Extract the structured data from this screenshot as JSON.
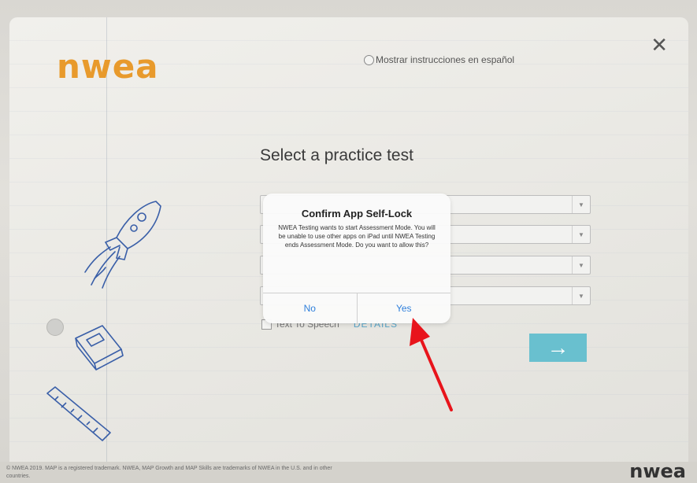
{
  "header": {
    "logo_text": "nwea",
    "language_option": "Mostrar instrucciones en español",
    "close_symbol": "✕"
  },
  "main": {
    "title": "Select a practice test",
    "selects": [
      {
        "value": ""
      },
      {
        "value": ""
      },
      {
        "value": ""
      },
      {
        "value": ""
      }
    ],
    "text_to_speech_label": "Text To Speech",
    "details_link": "DETAILS",
    "next_icon": "arrow-right-icon",
    "next_symbol": "→"
  },
  "dialog": {
    "title": "Confirm App Self-Lock",
    "message": "NWEA Testing wants to start Assessment Mode. You will be unable to use other apps on iPad until NWEA Testing ends Assessment Mode. Do you want to allow this?",
    "no_label": "No",
    "yes_label": "Yes"
  },
  "footer": {
    "copyright": "© NWEA 2019. MAP is a registered trademark. NWEA, MAP Growth and MAP Skills are trademarks of NWEA in the U.S. and in other countries.",
    "logo_text": "nwea"
  },
  "colors": {
    "brand_orange": "#e89a2c",
    "next_button": "#69c0cf",
    "ios_blue": "#2f7fdc",
    "annotation_arrow": "#e8141b"
  }
}
